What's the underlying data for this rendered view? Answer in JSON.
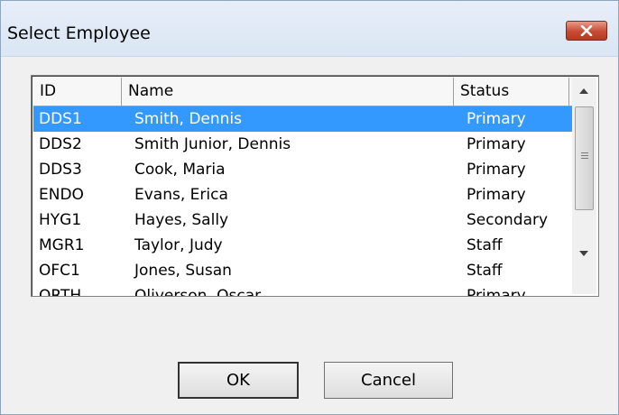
{
  "window": {
    "title": "Select Employee"
  },
  "list": {
    "columns": [
      "ID",
      "Name",
      "Status"
    ],
    "rows": [
      {
        "id": "DDS1",
        "name": "Smith, Dennis",
        "status": "Primary",
        "selected": true
      },
      {
        "id": "DDS2",
        "name": "Smith Junior, Dennis",
        "status": "Primary",
        "selected": false
      },
      {
        "id": "DDS3",
        "name": "Cook, Maria",
        "status": "Primary",
        "selected": false
      },
      {
        "id": "ENDO",
        "name": "Evans, Erica",
        "status": "Primary",
        "selected": false
      },
      {
        "id": "HYG1",
        "name": "Hayes, Sally",
        "status": "Secondary",
        "selected": false
      },
      {
        "id": "MGR1",
        "name": "Taylor, Judy",
        "status": "Staff",
        "selected": false
      },
      {
        "id": "OFC1",
        "name": "Jones, Susan",
        "status": "Staff",
        "selected": false
      },
      {
        "id": "ORTH",
        "name": "Oliverson, Oscar",
        "status": "Primary",
        "selected": false
      }
    ]
  },
  "buttons": {
    "ok": "OK",
    "cancel": "Cancel"
  },
  "colors": {
    "selection": "#3399ff",
    "close_button": "#c74a34"
  },
  "icons": {
    "close": "close-icon",
    "scroll_up": "arrow-up-icon",
    "scroll_down": "arrow-down-icon"
  }
}
